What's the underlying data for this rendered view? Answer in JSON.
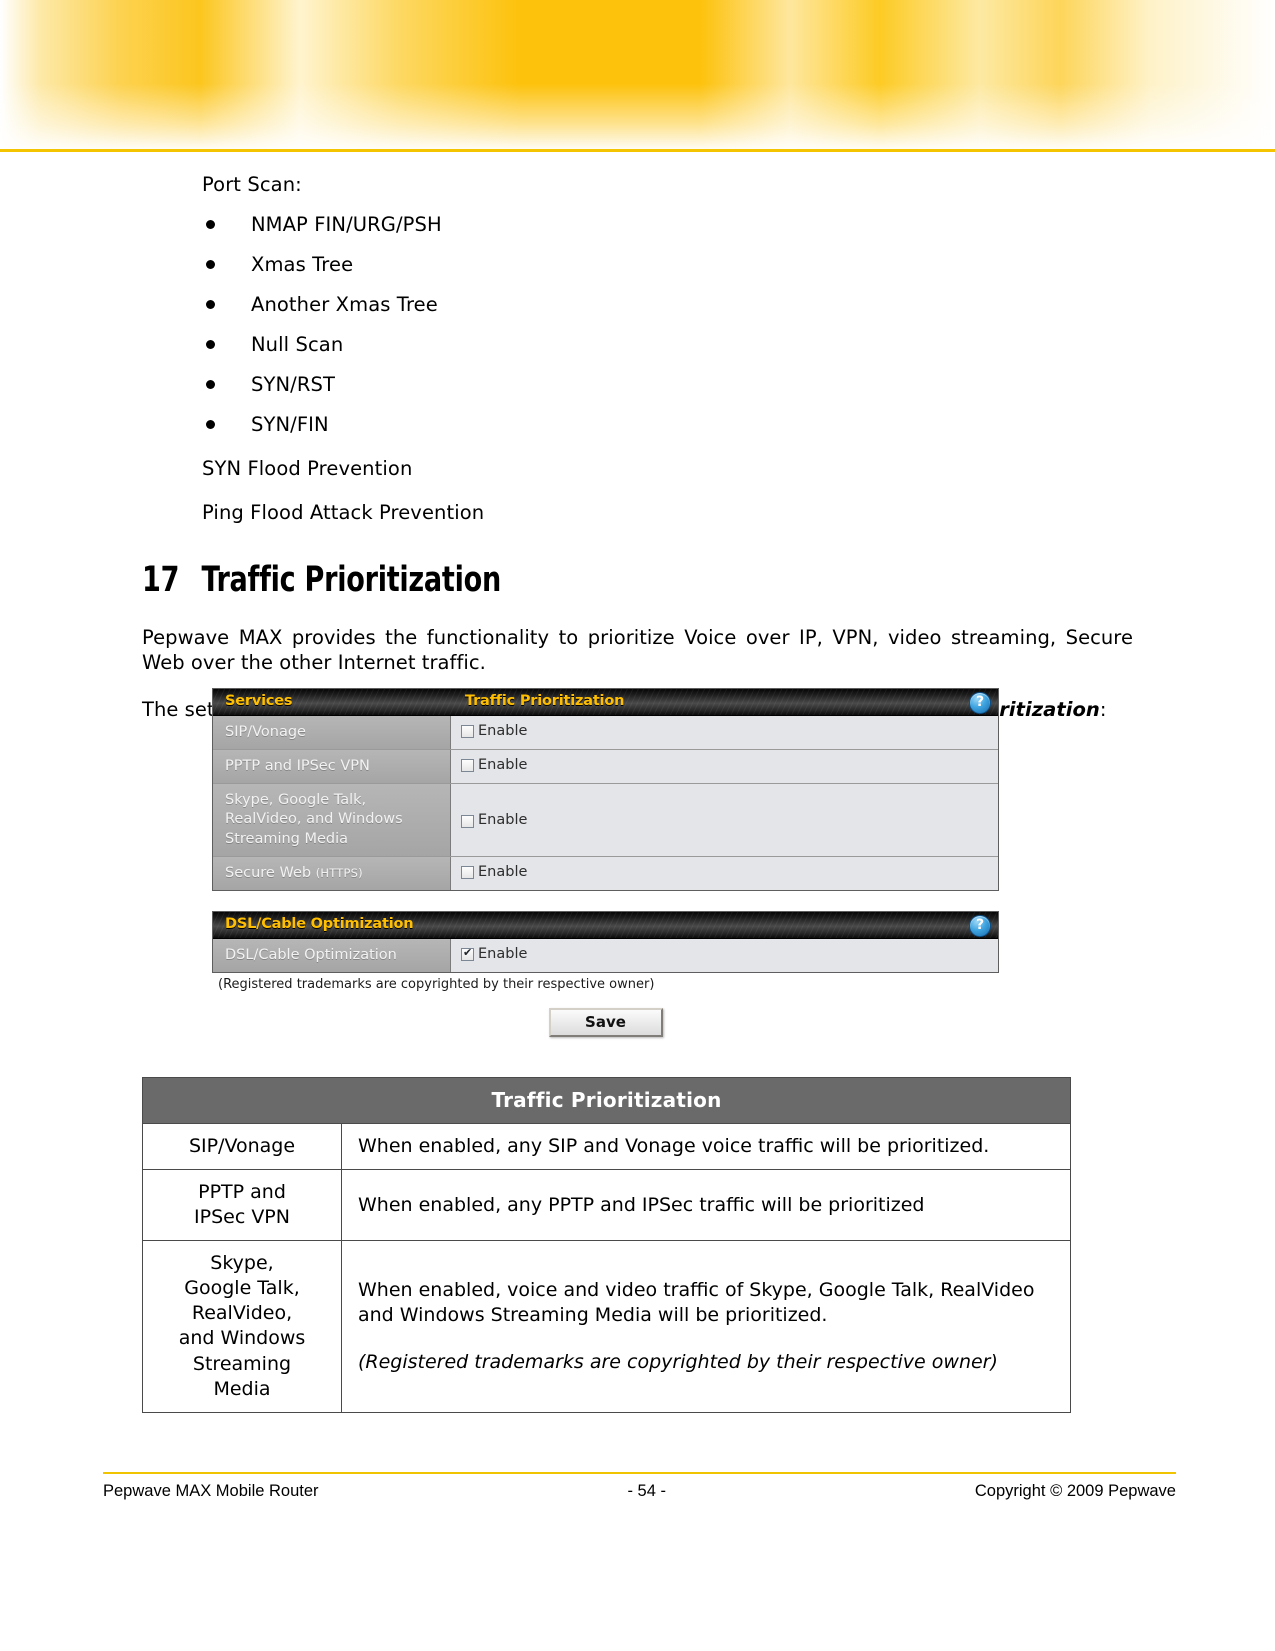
{
  "page": {
    "port_scan_label": "Port Scan:",
    "port_scan_items": [
      "NMAP FIN/URG/PSH",
      "Xmas Tree",
      "Another Xmas Tree",
      "Null Scan",
      "SYN/RST",
      "SYN/FIN"
    ],
    "syn_flood": "SYN Flood Prevention",
    "ping_flood": "Ping Flood Attack Prevention",
    "heading_number": "17",
    "heading_title": "Traffic Prioritization",
    "paragraph_1": "Pepwave MAX provides the functionality to prioritize Voice over IP, VPN, video streaming, Secure Web over the other Internet traffic.",
    "paragraph_2_pre": "The settings for configuring Quality of Service are located at ",
    "paragraph_2_emphasis": "Advanced > Traffic Prioritization",
    "paragraph_2_post": ":"
  },
  "ui": {
    "panel_services": {
      "header_left": "Services",
      "header_right": "Traffic Prioritization",
      "help_glyph": "?",
      "rows": [
        {
          "label": "SIP/Vonage",
          "label_small": "",
          "checkbox_label": "Enable",
          "checked": false
        },
        {
          "label": "PPTP and IPSec VPN",
          "label_small": "",
          "checkbox_label": "Enable",
          "checked": false
        },
        {
          "label": "Skype, Google Talk,\nRealVideo, and Windows\nStreaming Media",
          "label_small": "",
          "checkbox_label": "Enable",
          "checked": false
        },
        {
          "label": "Secure Web ",
          "label_small": "(HTTPS)",
          "checkbox_label": "Enable",
          "checked": false
        }
      ]
    },
    "panel_dsl": {
      "header_left": "DSL/Cable Optimization",
      "help_glyph": "?",
      "rows": [
        {
          "label": "DSL/Cable Optimization",
          "label_small": "",
          "checkbox_label": "Enable",
          "checked": true
        }
      ]
    },
    "trademark_note": "(Registered trademarks are copyrighted by their respective owner)",
    "save_label": "Save"
  },
  "desc_table": {
    "title": "Traffic Prioritization",
    "rows": [
      {
        "term": "SIP/Vonage",
        "desc": "When enabled, any SIP and Vonage voice traffic will be prioritized.",
        "note": ""
      },
      {
        "term": "PPTP and\nIPSec VPN",
        "desc": "When enabled, any PPTP and IPSec traffic will be prioritized",
        "note": ""
      },
      {
        "term": "Skype,\nGoogle Talk,\nRealVideo,\nand Windows\nStreaming\nMedia",
        "desc": "When enabled, voice and video traffic of Skype, Google Talk, RealVideo and Windows Streaming Media will be prioritized.",
        "note": "(Registered trademarks are copyrighted by their respective owner)"
      }
    ]
  },
  "footer": {
    "left": "Pepwave MAX Mobile Router",
    "center": "- 54 -",
    "right": "Copyright © 2009 Pepwave"
  },
  "colors": {
    "banner_yellow": "#fdc20c",
    "panel_header_accent": "#ffbf00",
    "table_header_gray": "#6a6a6a",
    "footer_rule": "#f0c500"
  }
}
